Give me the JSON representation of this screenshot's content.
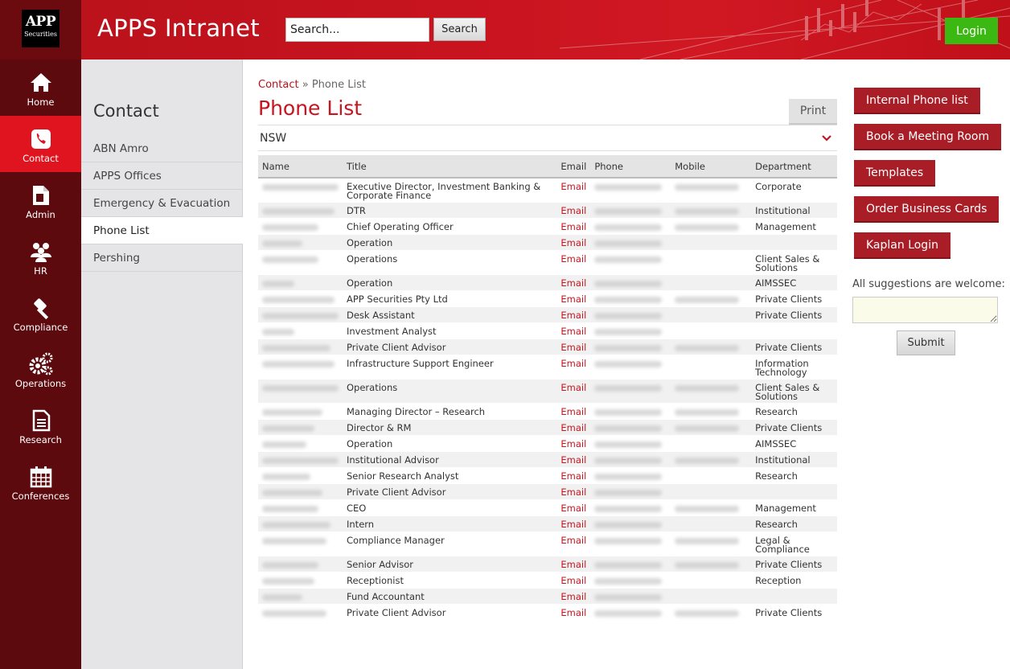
{
  "header": {
    "logo_top": "APP",
    "logo_bottom": "Securities",
    "app_title": "APPS Intranet",
    "search_placeholder": "Search...",
    "search_button": "Search",
    "login_button": "Login"
  },
  "leftnav": [
    {
      "label": "Home",
      "icon": "home-icon",
      "active": false
    },
    {
      "label": "Contact",
      "icon": "phone-icon",
      "active": true
    },
    {
      "label": "Admin",
      "icon": "document-icon",
      "active": false
    },
    {
      "label": "HR",
      "icon": "people-icon",
      "active": false
    },
    {
      "label": "Compliance",
      "icon": "gavel-icon",
      "active": false
    },
    {
      "label": "Operations",
      "icon": "gears-icon",
      "active": false
    },
    {
      "label": "Research",
      "icon": "page-icon",
      "active": false
    },
    {
      "label": "Conferences",
      "icon": "calendar-icon",
      "active": false
    }
  ],
  "subnav": {
    "title": "Contact",
    "items": [
      "ABN Amro",
      "APPS Offices",
      "Emergency & Evacuation",
      "Phone List",
      "Pershing"
    ],
    "active_index": 3
  },
  "main": {
    "breadcrumb_link": "Contact",
    "breadcrumb_sep": "»",
    "breadcrumb_current": "Phone List",
    "page_title": "Phone List",
    "print_button": "Print",
    "state_selected": "NSW",
    "columns": [
      "Name",
      "Title",
      "Email",
      "Phone",
      "Mobile",
      "Department"
    ],
    "email_link_text": "Email",
    "rows": [
      {
        "title": "Executive Director, Investment Banking & Corporate Finance",
        "dept": "Corporate",
        "mobile": true
      },
      {
        "title": "DTR",
        "dept": "Institutional",
        "mobile": true
      },
      {
        "title": "Chief Operating Officer",
        "dept": "Management",
        "mobile": true
      },
      {
        "title": "Operation",
        "dept": "",
        "mobile": false
      },
      {
        "title": "Operations",
        "dept": "Client Sales & Solutions",
        "mobile": false
      },
      {
        "title": "Operation",
        "dept": "AIMSSEC",
        "mobile": false
      },
      {
        "title": "APP Securities Pty Ltd",
        "dept": "Private Clients",
        "mobile": true
      },
      {
        "title": "Desk Assistant",
        "dept": "Private Clients",
        "mobile": false
      },
      {
        "title": "Investment Analyst",
        "dept": "",
        "mobile": false
      },
      {
        "title": "Private Client Advisor",
        "dept": "Private Clients",
        "mobile": true
      },
      {
        "title": "Infrastructure Support Engineer",
        "dept": "Information Technology",
        "mobile": false
      },
      {
        "title": "Operations",
        "dept": "Client Sales & Solutions",
        "mobile": true
      },
      {
        "title": "Managing Director – Research",
        "dept": "Research",
        "mobile": true
      },
      {
        "title": "Director & RM",
        "dept": "Private Clients",
        "mobile": true
      },
      {
        "title": "Operation",
        "dept": "AIMSSEC",
        "mobile": false
      },
      {
        "title": "Institutional Advisor",
        "dept": "Institutional",
        "mobile": true
      },
      {
        "title": "Senior Research Analyst",
        "dept": "Research",
        "mobile": false
      },
      {
        "title": "Private Client Advisor",
        "dept": "",
        "mobile": false
      },
      {
        "title": "CEO",
        "dept": "Management",
        "mobile": true
      },
      {
        "title": "Intern",
        "dept": "Research",
        "mobile": false
      },
      {
        "title": "Compliance Manager",
        "dept": "Legal & Compliance",
        "mobile": true
      },
      {
        "title": "Senior Advisor",
        "dept": "Private Clients",
        "mobile": true
      },
      {
        "title": "Receptionist",
        "dept": "Reception",
        "mobile": false
      },
      {
        "title": "Fund Accountant",
        "dept": "",
        "mobile": false
      },
      {
        "title": "Private Client Advisor",
        "dept": "Private Clients",
        "mobile": true
      }
    ]
  },
  "right": {
    "buttons": [
      "Internal Phone list",
      "Book a Meeting Room",
      "Templates",
      "Order Business Cards",
      "Kaplan Login"
    ],
    "suggestions_label": "All suggestions are welcome:",
    "submit_button": "Submit"
  },
  "colors": {
    "brand_red": "#c8141f",
    "dark_red": "#5c0a0e",
    "button_red": "#a91d26",
    "login_green": "#3cb813"
  }
}
